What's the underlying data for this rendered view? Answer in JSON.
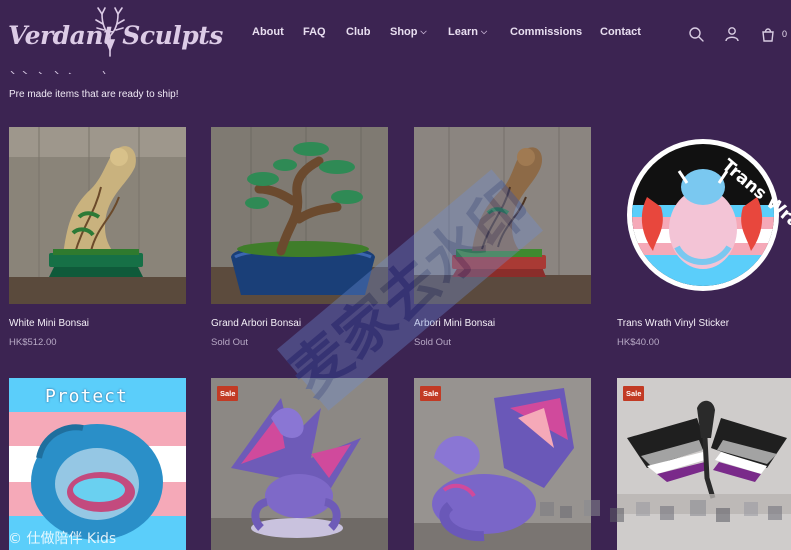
{
  "header": {
    "logo_text": "Verdant Sculpts",
    "nav": [
      {
        "label": "About",
        "dropdown": false
      },
      {
        "label": "FAQ",
        "dropdown": false
      },
      {
        "label": "Club",
        "dropdown": false
      },
      {
        "label": "Shop",
        "dropdown": true
      },
      {
        "label": "Learn",
        "dropdown": true
      },
      {
        "label": "Commissions",
        "dropdown": false
      },
      {
        "label": "Contact",
        "dropdown": false
      }
    ],
    "icons": [
      "search-icon",
      "account-icon",
      "cart-icon"
    ],
    "cart_count": "0"
  },
  "page": {
    "subtitle": "Pre made items that are ready to ship!"
  },
  "products": [
    {
      "title": "White Mini Bonsai",
      "price": "HK$512.00",
      "sale": false
    },
    {
      "title": "Grand Arbori Bonsai",
      "price": "Sold Out",
      "sale": false
    },
    {
      "title": "Arbori Mini Bonsai",
      "price": "Sold Out",
      "sale": false
    },
    {
      "title": "Trans Wrath Vinyl Sticker",
      "price": "HK$40.00",
      "sale": false
    },
    {
      "title": "",
      "price": "",
      "sale": false,
      "image_text": "Protect"
    },
    {
      "title": "",
      "price": "",
      "sale": true,
      "badge": "Sale"
    },
    {
      "title": "",
      "price": "",
      "sale": true,
      "badge": "Sale"
    },
    {
      "title": "",
      "price": "",
      "sale": true,
      "badge": "Sale"
    }
  ],
  "sticker_text": "Trans Wrath",
  "watermark_text": "麦家去水印",
  "footer_overlay_text": "© 仕做陪伴 Kids",
  "colors": {
    "background": "#3c2452",
    "text": "#ffffff",
    "muted": "#b8aac6",
    "sale_badge": "#c23a24"
  }
}
